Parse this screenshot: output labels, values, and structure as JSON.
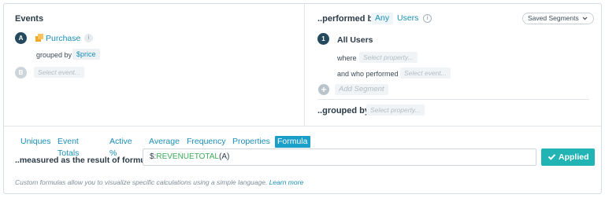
{
  "events": {
    "title": "Events",
    "items": [
      {
        "letter": "A",
        "name": "Purchase",
        "grouped_by_label": "grouped by",
        "grouped_by_value": "$price"
      },
      {
        "letter": "B",
        "placeholder": "Select event..."
      }
    ]
  },
  "performed_by": {
    "title": "..performed by",
    "any_label": "Any",
    "users_label": "Users",
    "saved_segments_label": "Saved Segments",
    "segments": [
      {
        "number": "1",
        "name": "All Users",
        "where_label": "where",
        "where_placeholder": "Select property...",
        "and_who_label": "and who performed",
        "and_who_placeholder": "Select event..."
      }
    ],
    "add_segment_label": "Add Segment"
  },
  "grouped_by": {
    "title": "..grouped by",
    "placeholder": "Select property..."
  },
  "tabs": [
    {
      "label": "Uniques",
      "active": false
    },
    {
      "label": "Event Totals",
      "active": false
    },
    {
      "label": "Active %",
      "active": false
    },
    {
      "label": "Average",
      "active": false
    },
    {
      "label": "Frequency",
      "active": false
    },
    {
      "label": "Properties",
      "active": false
    },
    {
      "label": "Formula",
      "active": true
    }
  ],
  "formula": {
    "label": "..measured as the result of formula",
    "value_prefix": "$:",
    "value_function": "REVENUETOTAL",
    "value_args": "(A)",
    "applied_label": "Applied"
  },
  "footnote": {
    "text": "Custom formulas allow you to visualize specific calculations using a simple language.",
    "link_label": "Learn more"
  },
  "colors": {
    "accent": "#1a8fb5",
    "applied": "#22b3b5",
    "function": "#3aab58",
    "event_icon": "#f5a623"
  }
}
